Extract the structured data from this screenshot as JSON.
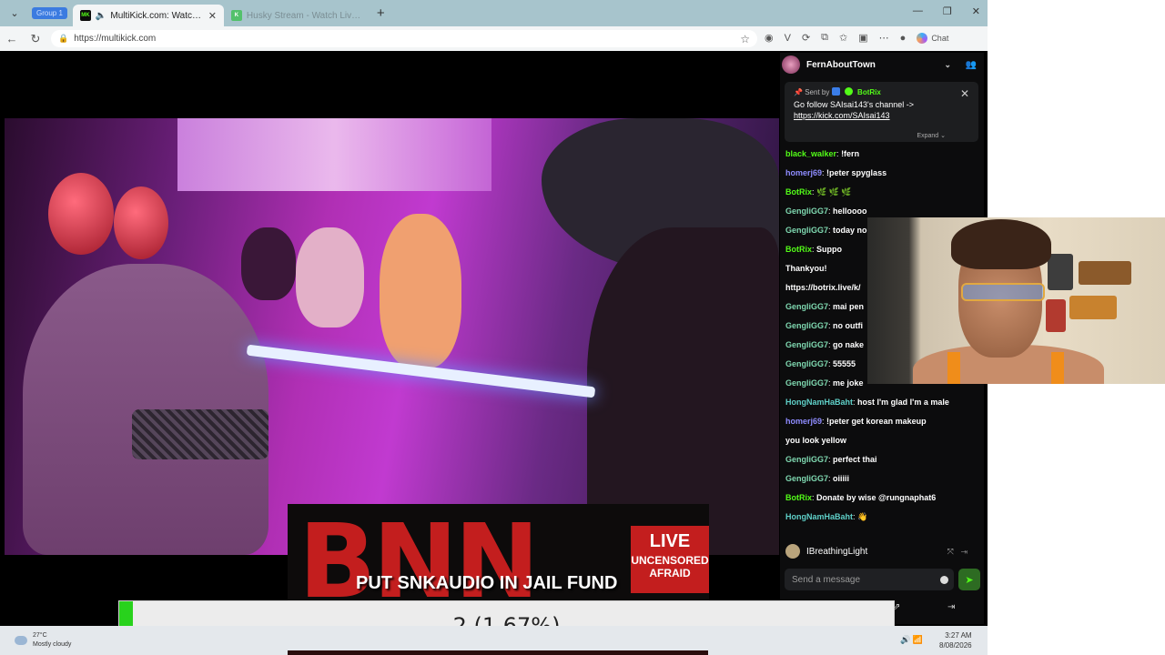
{
  "browser": {
    "group_label": "Group 1",
    "tabs": [
      {
        "label": "MultiKick.com: Watch Multiple",
        "favicon": "MK",
        "active": true
      },
      {
        "label": "Husky Stream - Watch Live on Ki",
        "favicon": "K",
        "active": false
      }
    ],
    "url": "https://multikick.com",
    "copilot_label": "Chat"
  },
  "overlay": {
    "bnn_text": "BNN",
    "live": "LIVE",
    "uncensored": "UNCENSORED",
    "afraid": "AFRAID",
    "ticker": "PUT SNKAUDIO IN JAIL FUND"
  },
  "chat": {
    "channel": "FernAboutTown",
    "pinned": {
      "sent_by_label": "Sent by",
      "sender": "BotRix",
      "message": "Go follow SAIsai143's channel ->",
      "link": "https://kick.com/SAIsai143",
      "expand": "Expand"
    },
    "messages": [
      {
        "user": "black_walker",
        "color": "#53fc18",
        "text": "!fern"
      },
      {
        "user": "homerj69",
        "color": "#8f8cff",
        "text": "!peter spyglass"
      },
      {
        "user": "BotRix",
        "color": "#53fc18",
        "text": "🌿 🌿 🌿"
      },
      {
        "user": "GengliGG7",
        "color": "#7fd8b0",
        "text": "helloooo"
      },
      {
        "user": "GengliGG7",
        "color": "#7fd8b0",
        "text": "today no"
      },
      {
        "user": "BotRix",
        "color": "#53fc18",
        "text": "Suppo"
      },
      {
        "user": "",
        "color": "#ffffff",
        "text": "Thankyou!"
      },
      {
        "user": "",
        "color": "#ffffff",
        "text": "https://botrix.live/k/"
      },
      {
        "user": "GengliGG7",
        "color": "#7fd8b0",
        "text": "mai pen"
      },
      {
        "user": "GengliGG7",
        "color": "#7fd8b0",
        "text": "no outfi"
      },
      {
        "user": "GengliGG7",
        "color": "#7fd8b0",
        "text": "go nake"
      },
      {
        "user": "GengliGG7",
        "color": "#7fd8b0",
        "text": "55555"
      },
      {
        "user": "GengliGG7",
        "color": "#7fd8b0",
        "text": "me joke"
      },
      {
        "user": "HongNamHaBaht",
        "color": "#5fd0c8",
        "text": "host I'm glad I'm a male"
      },
      {
        "user": "homerj69",
        "color": "#8f8cff",
        "text": "!peter get korean makeup"
      },
      {
        "user": "",
        "color": "#ffffff",
        "text": "you look yellow"
      },
      {
        "user": "GengliGG7",
        "color": "#7fd8b0",
        "text": "perfect thai"
      },
      {
        "user": "GengliGG7",
        "color": "#7fd8b0",
        "text": "oiiiii"
      },
      {
        "user": "BotRix",
        "color": "#53fc18",
        "text": "Donate by wise @rungnaphat6"
      },
      {
        "user": "HongNamHaBaht",
        "color": "#5fd0c8",
        "text": "👋"
      }
    ],
    "current_user": "IBreathingLight",
    "input_placeholder": "Send a message"
  },
  "progress": {
    "label": "2 (1.67%)",
    "fraction": 0.0167
  },
  "taskbar": {
    "temperature": "27°C",
    "weather": "Mostly cloudy",
    "time": "3:27 AM",
    "date": "8/08/2026"
  }
}
